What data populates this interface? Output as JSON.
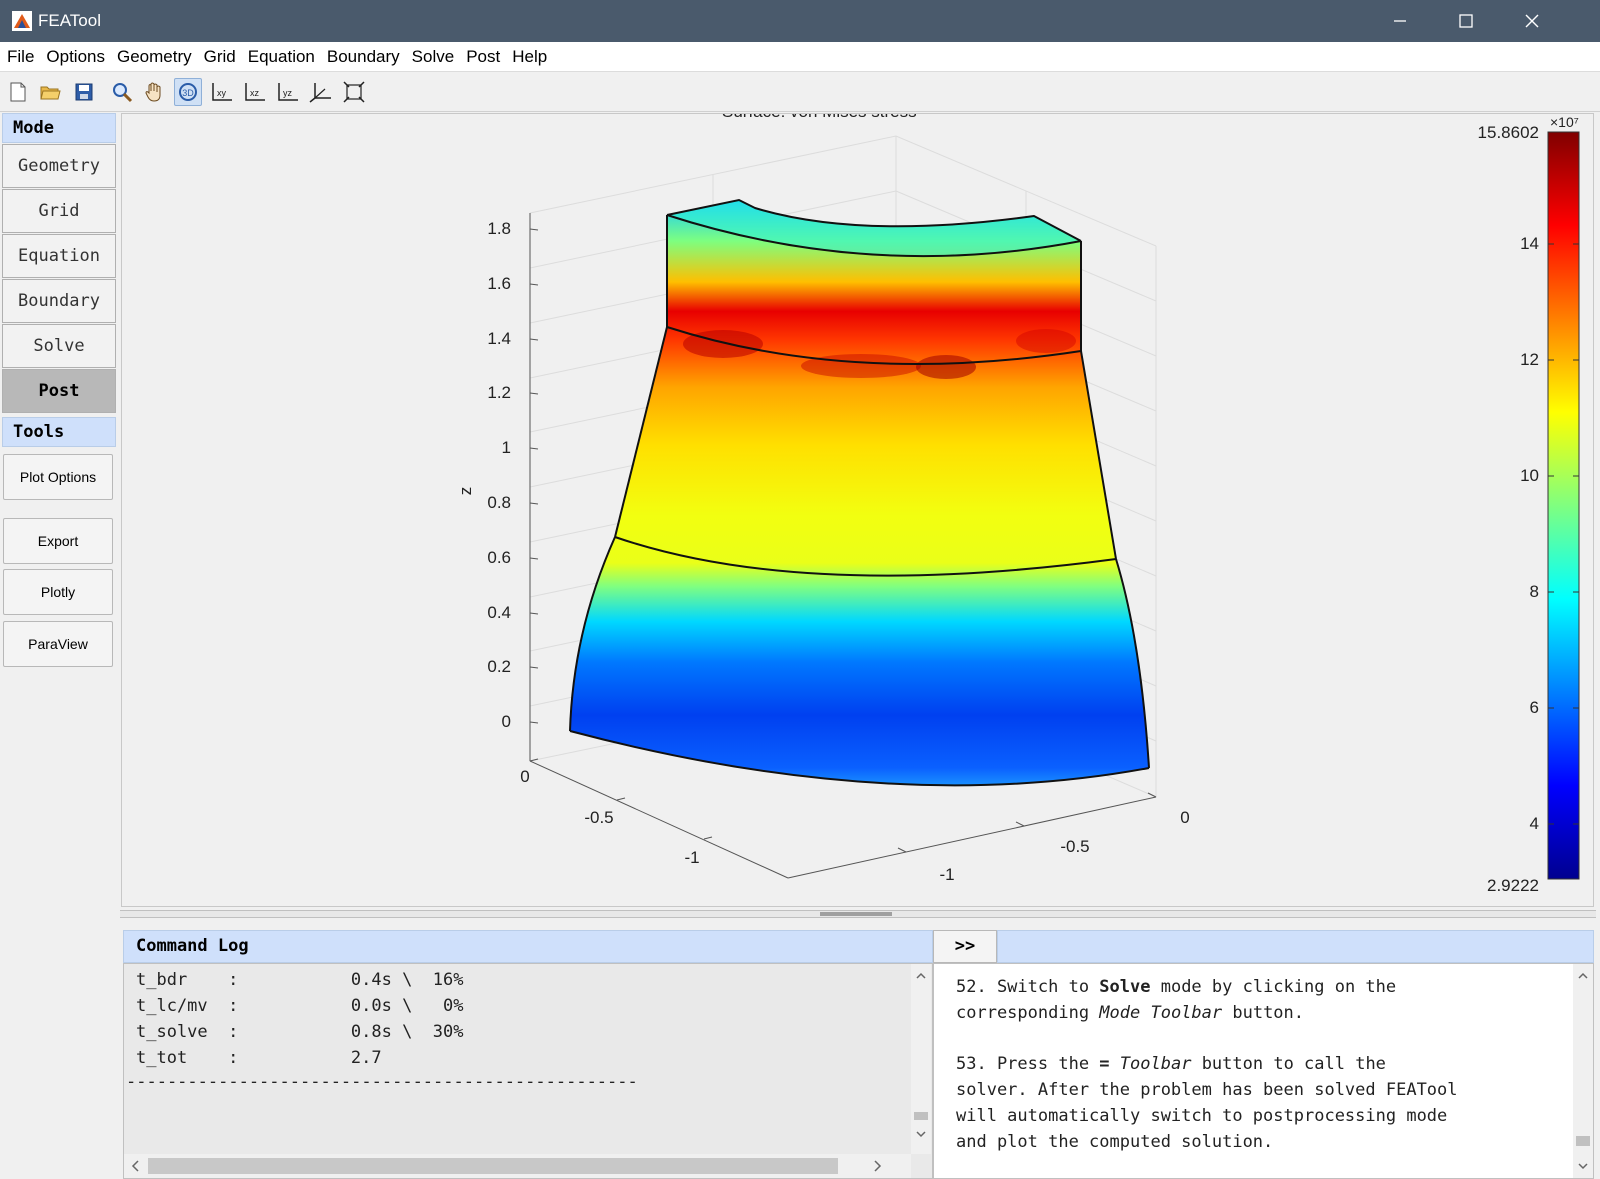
{
  "window": {
    "title": "FEATool",
    "minimize_icon": "minimize-icon",
    "maximize_icon": "maximize-icon",
    "close_icon": "close-icon"
  },
  "menu": [
    "File",
    "Options",
    "Geometry",
    "Grid",
    "Equation",
    "Boundary",
    "Solve",
    "Post",
    "Help"
  ],
  "toolbar": [
    {
      "icon": "new-file-icon"
    },
    {
      "icon": "open-folder-icon"
    },
    {
      "icon": "save-icon"
    },
    {
      "icon": "zoom-icon"
    },
    {
      "icon": "pan-hand-icon"
    },
    {
      "icon": "rotate-3d-icon",
      "active": true
    },
    {
      "icon": "view-xy-icon"
    },
    {
      "icon": "view-xz-icon"
    },
    {
      "icon": "view-yz-icon"
    },
    {
      "icon": "view-3d-axes-icon"
    },
    {
      "icon": "zoom-extents-icon"
    }
  ],
  "sidebar": {
    "mode_label": "Mode",
    "modes": [
      "Geometry",
      "Grid",
      "Equation",
      "Boundary",
      "Solve",
      "Post"
    ],
    "selected_mode": "Post",
    "tools_label": "Tools",
    "tools": [
      "Plot Options",
      "Export",
      "Plotly",
      "ParaView"
    ]
  },
  "plot": {
    "title": "Surface: von Mises stress",
    "zlabel": "z",
    "z_ticks": [
      "1.8",
      "1.6",
      "1.4",
      "1.2",
      "1",
      "0.8",
      "0.6",
      "0.4",
      "0.2",
      "0"
    ],
    "x_ticks": [
      "0",
      "-0.5",
      "-1"
    ],
    "y_ticks": [
      "0",
      "-0.5",
      "-1"
    ],
    "colorbar": {
      "max_label": "15.8602",
      "min_label": "2.9222",
      "exponent_label": "×10⁷",
      "ticks": [
        "14",
        "12",
        "10",
        "8",
        "6",
        "4"
      ],
      "colormap": "jet"
    }
  },
  "chart_data": {
    "type": "heatmap",
    "title": "Surface: von Mises stress",
    "zlabel": "z",
    "zlim": [
      0,
      1.8
    ],
    "color_range": [
      29222000.0,
      158602000.0
    ],
    "colorbar_ticks": [
      4,
      6,
      8,
      10,
      12,
      14
    ],
    "colorbar_scale": "×10⁷",
    "x_ticks": [
      0,
      -0.5,
      -1
    ],
    "y_ticks": [
      0,
      -0.5,
      -1
    ],
    "z_ticks": [
      0,
      0.2,
      0.4,
      0.6,
      0.8,
      1,
      1.2,
      1.4,
      1.6,
      1.8
    ],
    "grid": true,
    "colormap": "jet"
  },
  "command_log": {
    "label": "Command Log",
    "expand_label": ">>",
    "lines": [
      "t_bdr    :           0.4s \\  16%",
      "t_lc/mv  :           0.0s \\   0%",
      "t_solve  :           0.8s \\  30%",
      "t_tot    :           2.7",
      "--------------------------------------------------"
    ]
  },
  "help": {
    "p1_pre": "52. Switch to ",
    "p1_bold": "Solve",
    "p1_mid": " mode by clicking on the\ncorresponding ",
    "p1_italic": "Mode Toolbar",
    "p1_post": " button.",
    "p2_pre": "53. Press the ",
    "p2_bold": "=",
    "p2_sp": " ",
    "p2_italic": "Toolbar",
    "p2_post": " button to call the\nsolver. After the problem has been solved FEATool\nwill automatically switch to postprocessing mode\nand plot the computed solution."
  }
}
